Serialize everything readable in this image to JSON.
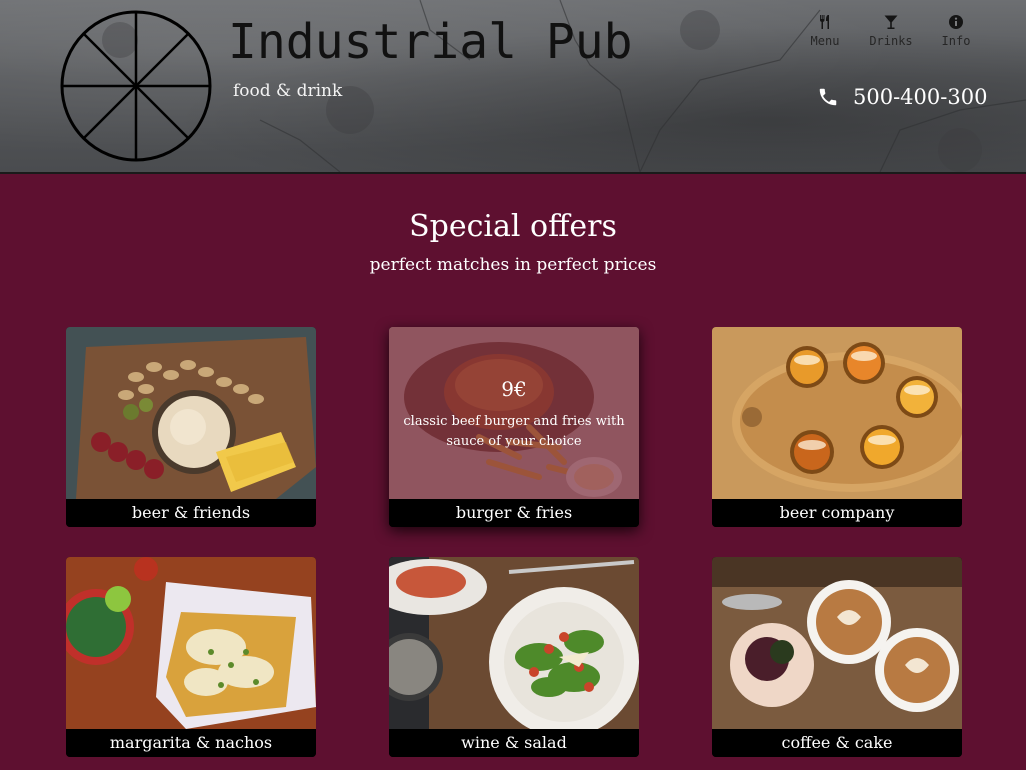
{
  "brand": {
    "title": "Industrial Pub",
    "tagline": "food & drink",
    "logo_icon": "pizza-wheel-logo"
  },
  "nav": [
    {
      "label": "Menu",
      "icon": "cutlery-icon"
    },
    {
      "label": "Drinks",
      "icon": "cocktail-glass-icon"
    },
    {
      "label": "Info",
      "icon": "info-icon"
    }
  ],
  "phone": {
    "number": "500-400-300",
    "icon": "phone-icon"
  },
  "offers": {
    "title": "Special offers",
    "subtitle": "perfect matches in perfect prices",
    "items": [
      {
        "caption": "beer & friends"
      },
      {
        "caption": "burger & fries",
        "price": "9€",
        "description": "classic beef burger and fries with sauce of your choice"
      },
      {
        "caption": "beer company"
      },
      {
        "caption": "margarita & nachos"
      },
      {
        "caption": "wine & salad"
      },
      {
        "caption": "coffee & cake"
      }
    ]
  },
  "colors": {
    "background": "#5e1030",
    "header_stone": "#5a5c5f",
    "caption_bar": "#000000",
    "text": "#ffffff"
  }
}
